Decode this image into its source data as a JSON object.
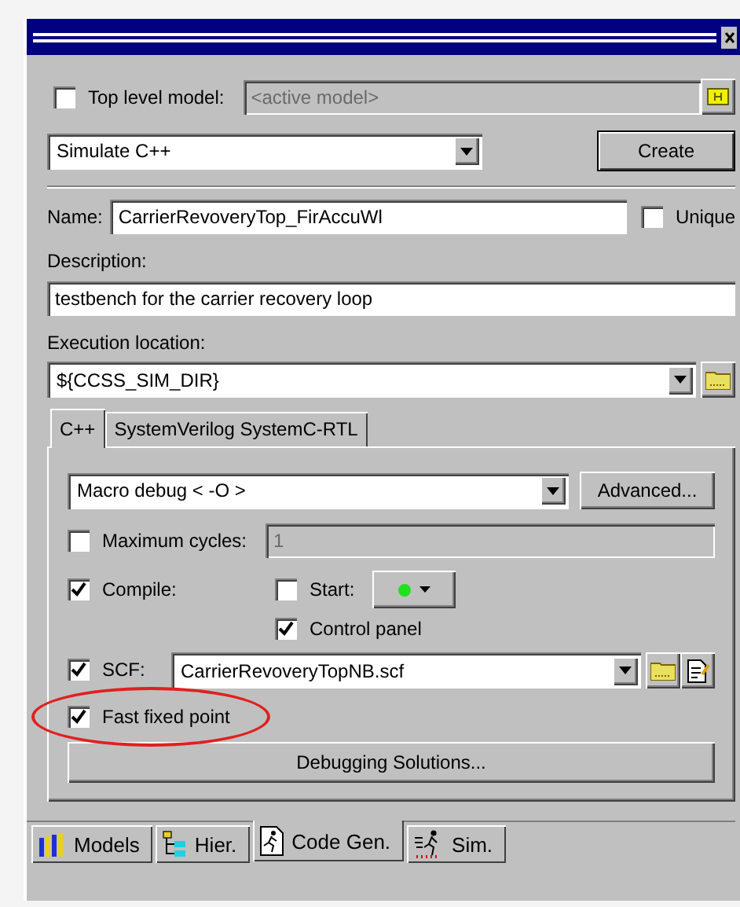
{
  "top_level_model": {
    "label": "Top level model:",
    "checked": false,
    "placeholder": "<active model>",
    "disabled": true
  },
  "mode_select": {
    "value": "Simulate C++"
  },
  "create_button": "Create",
  "name": {
    "label": "Name:",
    "value": "CarrierRevoveryTop_FirAccuWl"
  },
  "unique": {
    "label": "Unique",
    "checked": false
  },
  "description": {
    "label": "Description:",
    "value": "testbench for the carrier recovery loop"
  },
  "execution_location": {
    "label": "Execution location:",
    "value": "${CCSS_SIM_DIR}"
  },
  "tabs": [
    {
      "label": "C++",
      "selected": true
    },
    {
      "label": "SystemVerilog SystemC-RTL",
      "selected": false
    }
  ],
  "optimization_select": {
    "value": "Macro debug < -O >"
  },
  "advanced_button": "Advanced...",
  "maximum_cycles": {
    "label": "Maximum cycles:",
    "checked": false,
    "value": "1",
    "disabled": true
  },
  "compile": {
    "label": "Compile:",
    "checked": true
  },
  "start": {
    "label": "Start:",
    "checked": false
  },
  "control_panel": {
    "label": "Control panel",
    "checked": true
  },
  "scf": {
    "label": "SCF:",
    "checked": true,
    "value": "CarrierRevoveryTopNB.scf"
  },
  "fast_fixed_point": {
    "label": "Fast fixed point",
    "checked": true,
    "highlighted": true
  },
  "debugging_button": "Debugging Solutions...",
  "bottom_tabs": [
    {
      "label": "Models",
      "kind": "models",
      "selected": false
    },
    {
      "label": "Hier.",
      "kind": "hierarchy",
      "selected": false
    },
    {
      "label": "Code Gen.",
      "kind": "codegen",
      "selected": true
    },
    {
      "label": "Sim.",
      "kind": "sim",
      "selected": false
    }
  ]
}
